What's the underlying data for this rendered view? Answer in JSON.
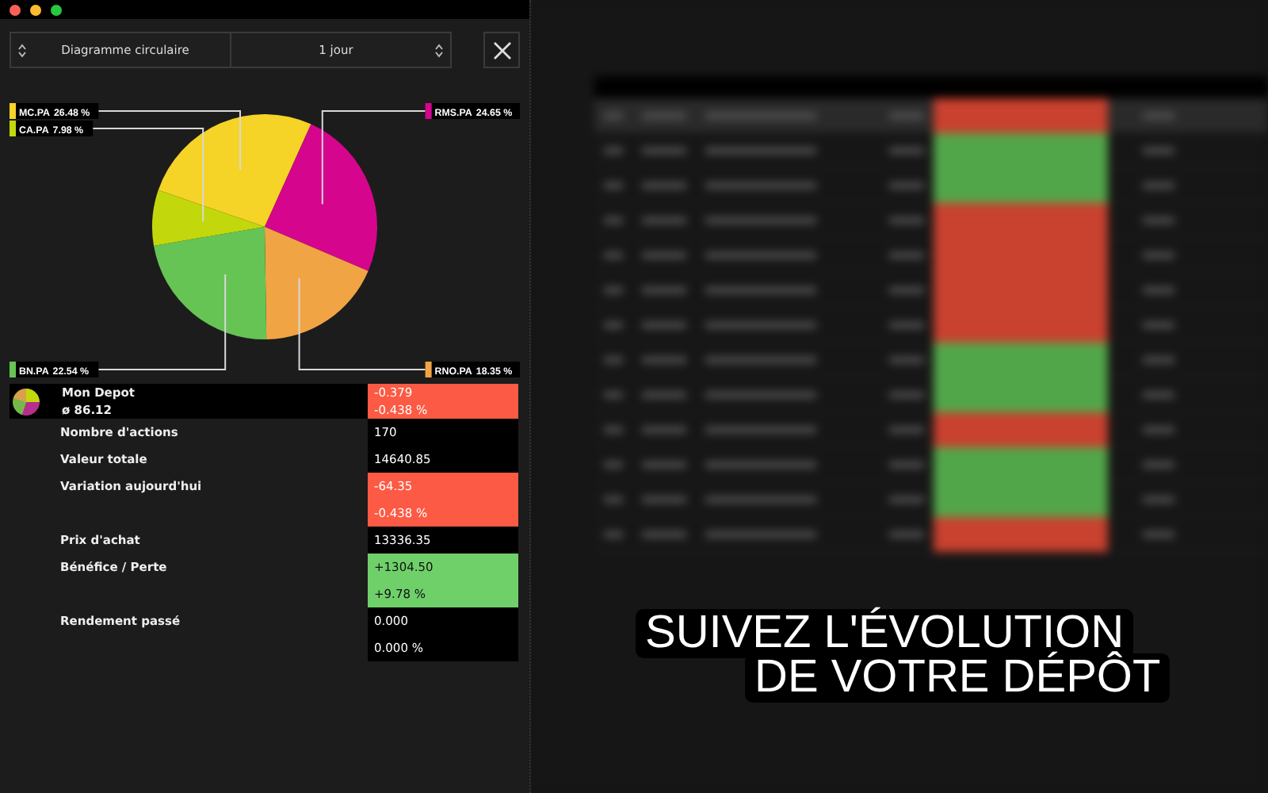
{
  "toolbar": {
    "chart_type": "Diagramme circulaire",
    "period": "1 jour"
  },
  "slices": [
    {
      "color": "#f5d327"
    },
    {
      "color": "#d6058d"
    },
    {
      "color": "#f1a444"
    },
    {
      "color": "#66c455"
    },
    {
      "color": "#c2d80c"
    }
  ],
  "chart_data": {
    "type": "pie",
    "categories": [
      "MC.PA",
      "RMS.PA",
      "RNO.PA",
      "BN.PA",
      "CA.PA"
    ],
    "values": [
      26.48,
      24.65,
      18.35,
      22.54,
      7.98
    ],
    "value_labels": [
      "26.48 %",
      "24.65 %",
      "18.35 %",
      "22.54 %",
      "7.98 %"
    ],
    "legend": true
  },
  "portfolio": {
    "name": "Mon Depot",
    "average": "ø 86.12",
    "values": [
      "-0.379",
      "-0.438 %"
    ],
    "kind": "negative"
  },
  "rows": [
    {
      "label": "Nombre d'actions",
      "values": [
        "170"
      ],
      "kind": "neutral"
    },
    {
      "label": "Valeur totale",
      "values": [
        "14640.85"
      ],
      "kind": "neutral"
    },
    {
      "label": "Variation aujourd'hui",
      "values": [
        "-64.35",
        "-0.438 %"
      ],
      "kind": "negative"
    },
    {
      "label": "Prix d'achat",
      "values": [
        "13336.35"
      ],
      "kind": "neutral"
    },
    {
      "label": "Bénéfice / Perte",
      "values": [
        "+1304.50",
        "+9.78 %"
      ],
      "kind": "positive"
    },
    {
      "label": "Rendement passé",
      "values": [
        "0.000",
        "0.000 %"
      ],
      "kind": "neutral"
    }
  ],
  "caption": [
    "SUIVEZ L'ÉVOLUTION",
    "DE VOTRE DÉPÔT"
  ]
}
